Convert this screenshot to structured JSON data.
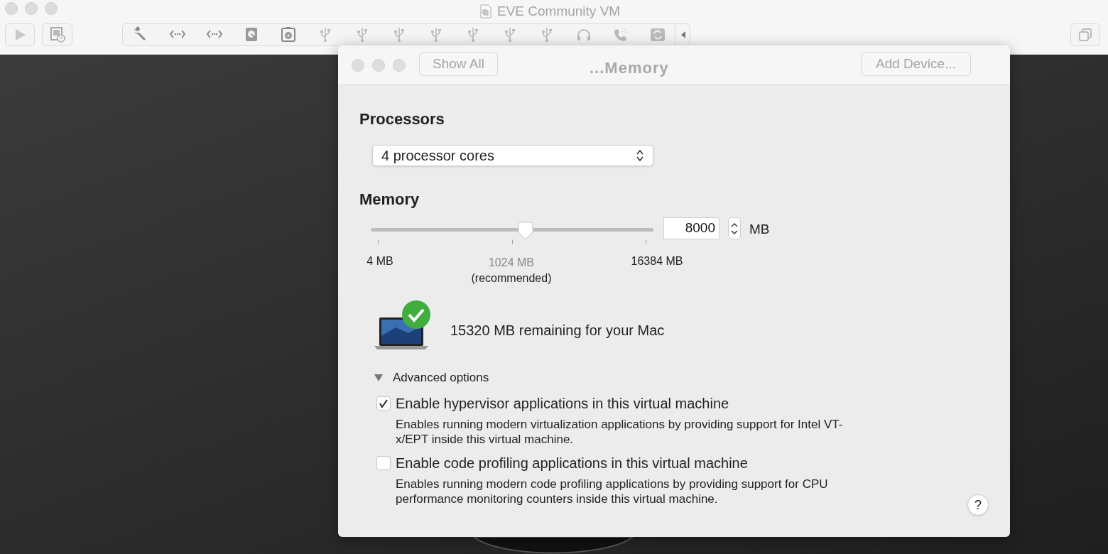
{
  "window": {
    "title": "EVE Community VM"
  },
  "sheet": {
    "title": "...Memory",
    "show_all_button": "Show All",
    "add_device_button": "Add Device...",
    "processors": {
      "heading": "Processors",
      "selected_option": "4 processor cores"
    },
    "memory": {
      "heading": "Memory",
      "slider": {
        "level": 0.548
      },
      "value": "8000",
      "unit": "MB",
      "tick_labels": [
        {
          "kind": "plain",
          "lines": [
            "4 MB"
          ]
        },
        {
          "kind": "recommended",
          "lines": [
            "1024 MB",
            "(recommended)"
          ]
        },
        {
          "kind": "plain",
          "lines": [
            "16384 MB"
          ]
        }
      ],
      "remaining": "15320 MB remaining for your Mac"
    },
    "advanced": {
      "label": "Advanced options",
      "expanded": true,
      "options": [
        {
          "label": "Enable hypervisor applications in this virtual machine",
          "checked": true,
          "description": "Enables running modern virtualization applications by providing support for Intel VT-x/EPT inside this virtual machine."
        },
        {
          "label": "Enable code profiling applications in this virtual machine",
          "checked": false,
          "description": "Enables running modern code profiling applications by providing support for CPU performance monitoring counters inside this virtual machine."
        }
      ]
    },
    "help_button": "?"
  }
}
